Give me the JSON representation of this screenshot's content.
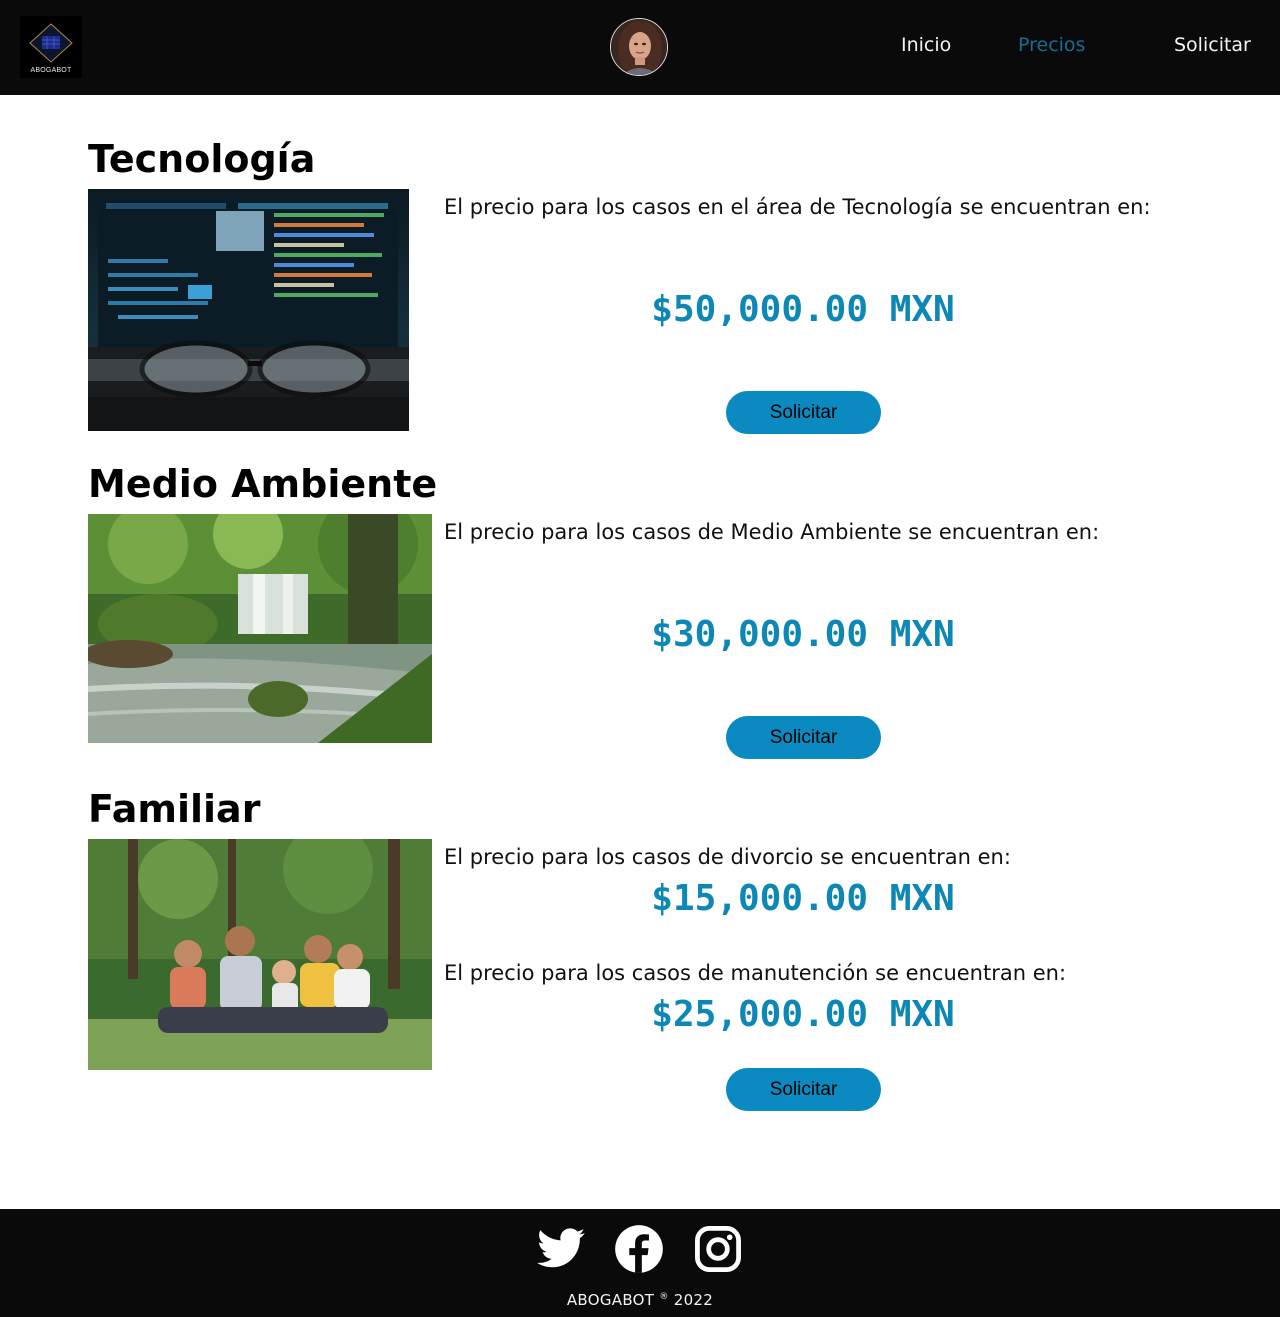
{
  "header": {
    "logo_text": "ABOGABOT",
    "nav": [
      {
        "label": "Inicio"
      },
      {
        "label": "Precios",
        "active": true
      },
      {
        "label": "Solicitar"
      }
    ]
  },
  "sections": [
    {
      "title": "Tecnología",
      "photo_subject": "laptop screen with code and glasses",
      "description": "El precio para los casos en el área de Tecnología se encuentran en:",
      "price": "$50,000.00 MXN",
      "button_label": "Solicitar"
    },
    {
      "title": "Medio Ambiente",
      "photo_subject": "forest waterfall and stream",
      "description": "El precio para los casos de Medio Ambiente se encuentran en:",
      "price": "$30,000.00 MXN",
      "button_label": "Solicitar"
    },
    {
      "title": "Familiar",
      "photo_subject": "family sitting on grass",
      "description_1": "El precio para los casos de divorcio se encuentran en:",
      "price_1": "$15,000.00 MXN",
      "description_2": "El precio para los casos de manutención se encuentran en:",
      "price_2": "$25,000.00 MXN",
      "button_label": "Solicitar"
    }
  ],
  "footer": {
    "social_icons": [
      "twitter-icon",
      "facebook-icon",
      "instagram-icon"
    ],
    "brand": "ABOGABOT",
    "registered_mark": "®",
    "year": "2022"
  },
  "colors": {
    "header_bg": "#0a0a0a",
    "accent": "#0a8ac0",
    "price": "#0d87b6",
    "nav_active": "#1a6a96"
  }
}
